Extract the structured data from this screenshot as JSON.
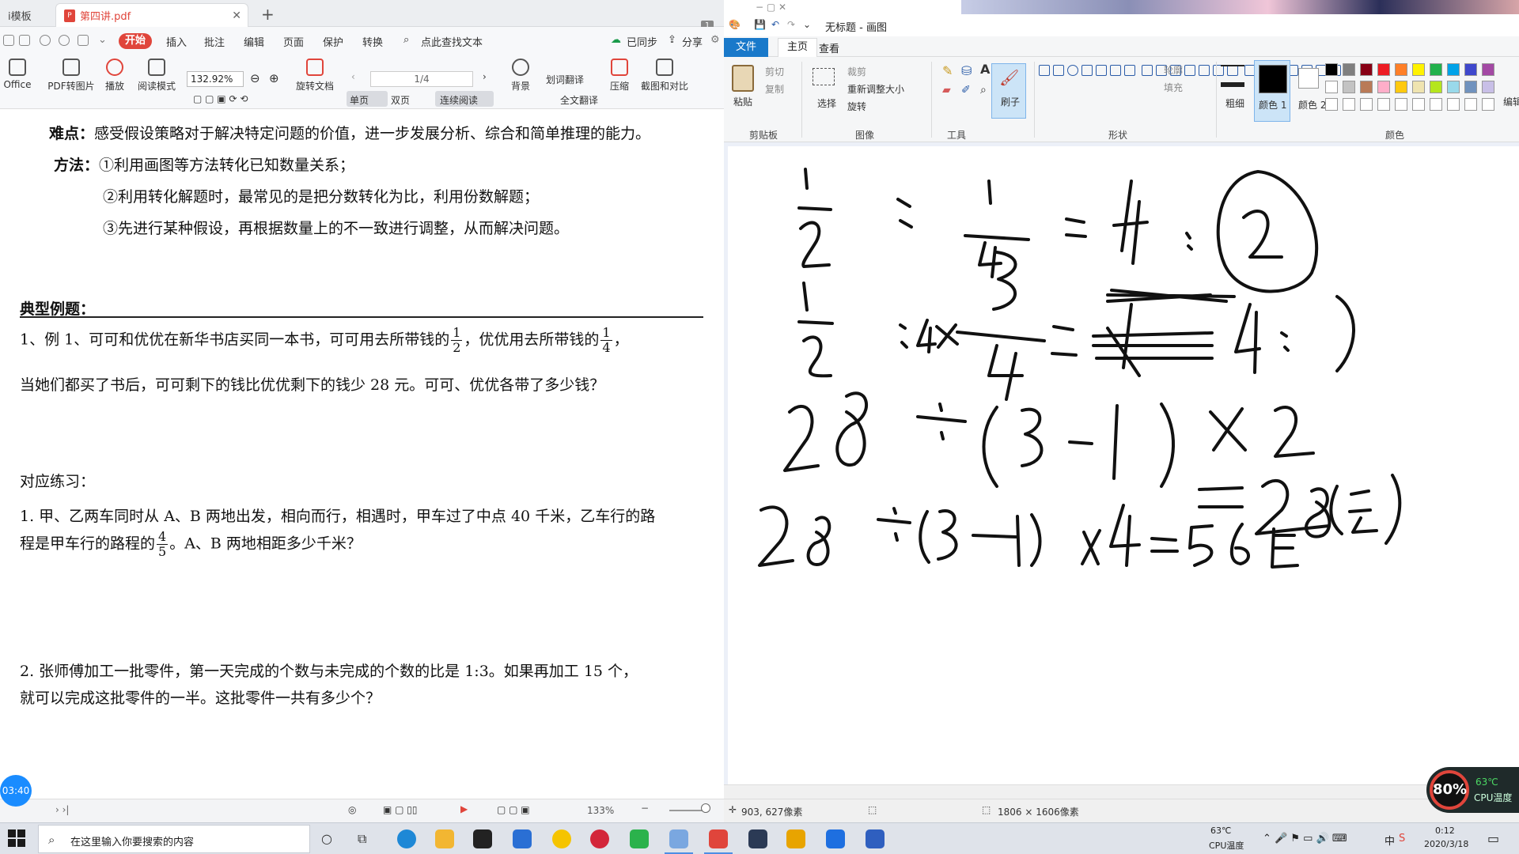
{
  "pdf": {
    "tabs": {
      "prev": "i模板",
      "active": "第四讲.pdf",
      "page_badge": "1"
    },
    "menu": {
      "start": "开始",
      "items": [
        "插入",
        "批注",
        "编辑",
        "页面",
        "保护",
        "转换"
      ],
      "find": "点此查找文本",
      "sync": "已同步",
      "share": "分享"
    },
    "toolbar": {
      "office": "Office",
      "pdf_to_img": "PDF转图片",
      "play": "播放",
      "read_mode": "阅读模式",
      "zoom": "132.92%",
      "page": "1/4",
      "rotate": "旋转文档",
      "single": "单页",
      "double": "双页",
      "continuous": "连续阅读",
      "translate_word": "划词翻译",
      "translate_all": "全文翻译",
      "background": "背景",
      "compress": "压缩",
      "screenshot": "截图和对比"
    },
    "content": {
      "difficulty_label": "难点：",
      "difficulty_text": "感受假设策略对于解决特定问题的价值，进一步发展分析、综合和简单推理的能力。",
      "method_label": "方法：",
      "method_1": "①利用画图等方法转化已知数量关系；",
      "method_2": "②利用转化解题时，最常见的是把分数转化为比，利用份数解题；",
      "method_3": "③先进行某种假设，再根据数量上的不一致进行调整，从而解决问题。",
      "section_title": "典型例题：",
      "ex1_a": "1、例 1、可可和优优在新华书店买同一本书，可可用去所带钱的",
      "ex1_frac1_num": "1",
      "ex1_frac1_den": "2",
      "ex1_b": "，优优用去所带钱的",
      "ex1_frac2_num": "1",
      "ex1_frac2_den": "4",
      "ex1_c": "，",
      "ex1_line2": "当她们都买了书后，可可剩下的钱比优优剩下的钱少 28 元。可可、优优各带了多少钱？",
      "practice_title": "对应练习：",
      "p1_line1": "1. 甲、乙两车同时从 A、B 两地出发，相向而行，相遇时，甲车过了中点 40 千米，乙车行的路",
      "p1_line2_a": "程是甲车行的路程的",
      "p1_frac_num": "4",
      "p1_frac_den": "5",
      "p1_line2_b": "。A、B 两地相距多少千米？",
      "p2_line1": "2. 张师傅加工一批零件，第一天完成的个数与未完成的个数的比是 1:3。如果再加工 15 个，",
      "p2_line2": "就可以完成这批零件的一半。这批零件一共有多少个？"
    },
    "status": {
      "zoom": "133%",
      "timer": "03:40"
    }
  },
  "paint": {
    "title": "无标题 - 画图",
    "tabs": {
      "file": "文件",
      "home": "主页",
      "view": "查看"
    },
    "ribbon": {
      "paste": "粘贴",
      "cut": "剪切",
      "copy": "复制",
      "clipboard": "剪贴板",
      "select": "选择",
      "crop": "裁剪",
      "resize": "重新调整大小",
      "rotate": "旋转",
      "image": "图像",
      "tools": "工具",
      "brush": "刷子",
      "shapes": "形状",
      "outline": "轮廓",
      "fill": "填充",
      "size": "粗细",
      "color1": "颜色 1",
      "color2": "颜色 2",
      "colors": "颜色",
      "edit_colors": "编辑颜色"
    },
    "palette": [
      "#000000",
      "#7f7f7f",
      "#880015",
      "#ed1c24",
      "#ff7f27",
      "#fff200",
      "#22b14c",
      "#00a2e8",
      "#3f48cc",
      "#a349a4",
      "#ffffff",
      "#c3c3c3",
      "#b97a57",
      "#ffaec9",
      "#ffc90e",
      "#efe4b0",
      "#b5e61d",
      "#99d9ea",
      "#7092be",
      "#c8bfe7"
    ],
    "status": {
      "cursor": "903, 627像素",
      "size": "1806 × 1606像素"
    }
  },
  "cpu": {
    "percent": "80%",
    "temp": "63℃",
    "label": "CPU温度"
  },
  "taskbar": {
    "search_placeholder": "在这里输入你要搜索的内容",
    "temp": "63℃",
    "temp_label": "CPU温度",
    "time": "0:12",
    "date": "2020/3/18",
    "ime": "中"
  }
}
